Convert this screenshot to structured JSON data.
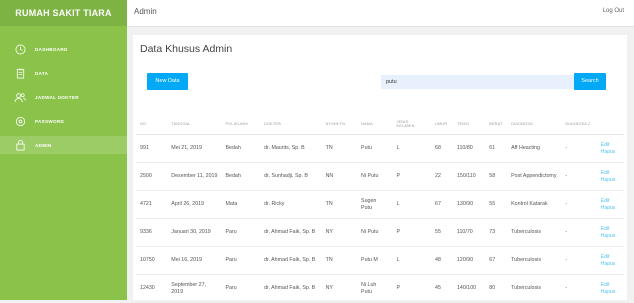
{
  "sidebar": {
    "brand": "RUMAH SAKIT TIARA",
    "items": [
      {
        "label": "DASHBOARD",
        "icon": "clock-icon"
      },
      {
        "label": "DATA",
        "icon": "clipboard-icon"
      },
      {
        "label": "JADWAL DOKTER",
        "icon": "users-icon"
      },
      {
        "label": "PASSWORD",
        "icon": "gear-icon"
      },
      {
        "label": "ADMIN",
        "icon": "lock-icon"
      }
    ]
  },
  "topbar": {
    "title": "Admin",
    "logout": "Log Out"
  },
  "main": {
    "heading": "Data Khusus Admin",
    "new_button": "New Data",
    "search_value": "putu",
    "search_button": "Search"
  },
  "table": {
    "headers": [
      "NO",
      "TANGGAL",
      "POLIKLINIK",
      "DOKTER",
      "NY/NN/TN",
      "NAMA",
      "JENIS KELAMIN",
      "UMUR",
      "TENSI",
      "BERAT",
      "DIAGNOSA",
      "DIAGNOSA 2",
      ""
    ],
    "rows": [
      [
        "991",
        "Mei 21, 2019",
        "Bedah",
        "dr. Maurits, Sp. B",
        "TN",
        "Putu",
        "L",
        "68",
        "110/80",
        "61",
        "Aff Heacting",
        "-"
      ],
      [
        "2500",
        "Desember 11, 2019",
        "Bedah",
        "dr. Sunhadji, Sp. B",
        "NN",
        "Ni Putu",
        "P",
        "22",
        "150/110",
        "58",
        "Post Appendictomy",
        "-"
      ],
      [
        "4721",
        "April 26, 2019",
        "Mata",
        "dr. Ricky",
        "TN",
        "Sugen Putu",
        "L",
        "67",
        "130/90",
        "55",
        "Kontrol Katarak",
        "-"
      ],
      [
        "9336",
        "Januari 30, 2019",
        "Paru",
        "dr. Ahmad Faik, Sp. B",
        "NY",
        "Ni Putu",
        "P",
        "55",
        "110/70",
        "73",
        "Tuberculosis",
        "-"
      ],
      [
        "10750",
        "Mei 16, 2019",
        "Paru",
        "dr. Ahmad Faik, Sp. B",
        "TN",
        "Putu M",
        "L",
        "48",
        "120/90",
        "67",
        "Tuberculosis",
        "-"
      ],
      [
        "12430",
        "September 27, 2019",
        "Paru",
        "dr. Ahmad Faik, Sp. B",
        "NY",
        "Ni Luh Putu",
        "P",
        "45",
        "140/100",
        "80",
        "Tuberculosis",
        "-"
      ]
    ],
    "edit_label": "Edit",
    "delete_label": "Hapus"
  },
  "colors": {
    "sidebar": "#8bc34a",
    "accent": "#03a9f4",
    "link": "#4fc3f7"
  }
}
